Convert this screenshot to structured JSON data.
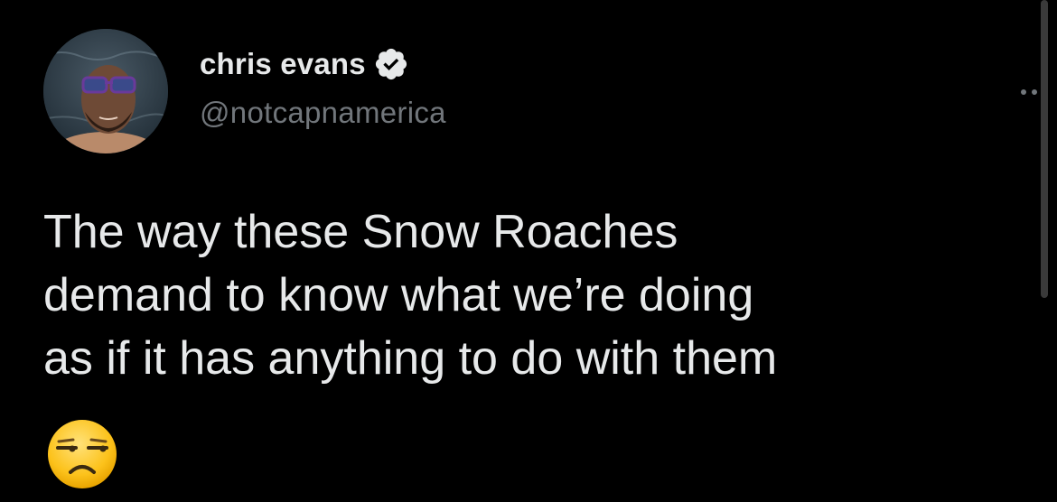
{
  "tweet": {
    "author": {
      "display_name": "chris evans",
      "handle": "@notcapnamerica",
      "verified": true
    },
    "more_icon": "more-horizontal-icon",
    "text_lines": [
      "The way these Snow Roaches",
      "demand to know what we’re doing",
      "as if it has anything to do with them"
    ],
    "emoji": "unamused-face"
  },
  "colors": {
    "background": "#000000",
    "text_primary": "#e7e9ea",
    "text_secondary": "#71767b",
    "verified_badge": "#e7e9ea"
  }
}
